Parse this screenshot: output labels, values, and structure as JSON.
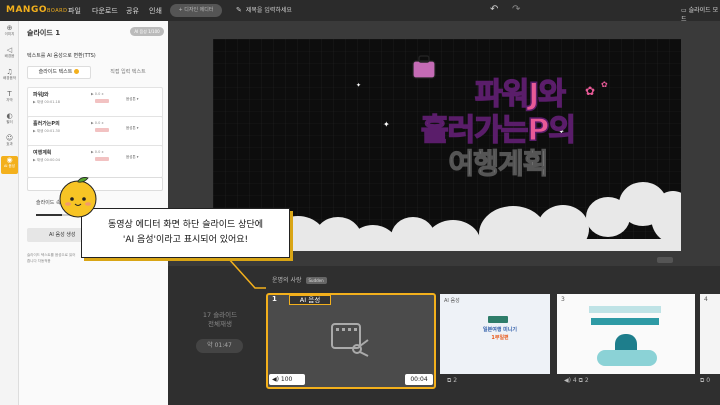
{
  "app": {
    "logo": "MANGO",
    "logo_sub": "BOARD",
    "menu": [
      "파일",
      "다운로드",
      "공유",
      "인쇄"
    ],
    "new_editor": "+ 디자인 에디터",
    "title_placeholder": "제목을 입력하세요",
    "mode_label": "슬라이드 모드"
  },
  "rail": {
    "items": [
      "이미지",
      "배경음",
      "배경음악",
      "자막",
      "필터",
      "캐릭터",
      "효과",
      "음성",
      "AI 음성"
    ]
  },
  "panel": {
    "slide_title": "슬라이드 1",
    "ai_badge": "AI 음성 1/100",
    "tts_title": "텍스트를 AI 음성으로 변환(TTS)",
    "tab_slide_text": "슬라이드 텍스트",
    "tab_direct": "직접 입력 텍스트",
    "items": [
      {
        "name": "파워J와",
        "meta": "▶ 재생 00:01.18",
        "speed": "▶ 0.0 x",
        "voice": "음성톤 ▾"
      },
      {
        "name": "흘러가는P의",
        "meta": "▶ 재생 00:01.30",
        "speed": "▶ 0.0 x",
        "voice": "음성톤 ▾"
      },
      {
        "name": "여행계획",
        "meta": "▶ 재생 00:00.04",
        "speed": "▶ 0.0 x",
        "voice": "음성톤 ▾"
      }
    ],
    "slider_label": "슬라이드 속도",
    "button_label": "AI 음성 생성",
    "note": "슬라이드 텍스트를 음성으로 읽어줍니다 자동적용"
  },
  "slide": {
    "title_line1": "파워J와",
    "title_line2": "흘러가는P의",
    "title_line3": "여행계획"
  },
  "timeline": {
    "header": "운명의 사랑",
    "header_tag": "Sudden",
    "total_line1": "17 슬라이드",
    "total_line2": "전체재생",
    "duration": "약 01:47",
    "slide1_num": "1",
    "ai_tag": "AI 음성",
    "slide1_volume": "100",
    "slide1_time": "00:04",
    "slide2_label": "AI 음성",
    "slide2_text1": "일본여행 미니기",
    "slide2_text2": "1부일편",
    "slide2_foot": "2",
    "slide3_num": "3",
    "slide3_foot1": "4",
    "slide3_foot2": "2",
    "slide4_num": "4",
    "slide4_foot": "0"
  },
  "callout": {
    "line1": "동영상 에디터 화면 하단 슬라이드 상단에",
    "line2": "'AI 음성'이라고 표시되어 있어요!"
  },
  "colors": {
    "accent": "#f3b01c",
    "pink": "#e85a97",
    "purple": "#7a2f8f",
    "dark_bg": "#2f2f2f"
  }
}
